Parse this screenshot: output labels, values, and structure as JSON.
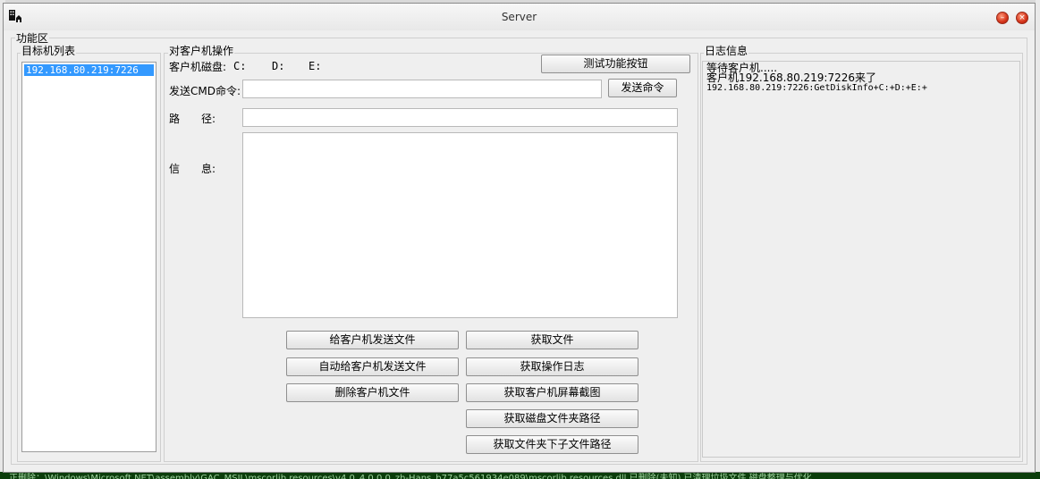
{
  "window": {
    "title": "Server"
  },
  "menu": {
    "function_area": "功能区"
  },
  "targets": {
    "title": "目标机列表",
    "items": [
      "192.168.80.219:7226"
    ]
  },
  "client_ops": {
    "title": "对客户机操作",
    "disk_label": "客户机磁盘:",
    "drives": [
      "C:",
      "D:",
      "E:"
    ],
    "test_button": "测试功能按钮",
    "cmd_label": "发送CMD命令:",
    "cmd_value": "",
    "send_cmd_button": "发送命令",
    "path_label": "路　　径:",
    "path_value": "",
    "info_label": "信　　息:",
    "info_value": "",
    "buttons": {
      "send_file": "给客户机发送文件",
      "auto_send_file": "自动给客户机发送文件",
      "delete_file": "删除客户机文件",
      "get_file": "获取文件",
      "get_log": "获取操作日志",
      "get_screenshot": "获取客户机屏幕截图",
      "get_disk_paths": "获取磁盘文件夹路径",
      "get_subfolder_paths": "获取文件夹下子文件路径"
    }
  },
  "log": {
    "title": "日志信息",
    "lines": [
      "等待客户机.....",
      "客户机192.168.80.219:7226来了",
      "192.168.80.219:7226:GetDiskInfo+C:+D:+E:+"
    ]
  },
  "background": {
    "bottom_text": "正删除：\\Windows\\Microsoft.NET\\assembly\\GAC_MSIL\\mscorlib.resources\\v4.0_4.0.0.0_zh-Hans_b77a5c561934e089\\mscorlib.resources.dll   已删除(未知)   已清理垃圾文件   磁盘整理与优化"
  }
}
